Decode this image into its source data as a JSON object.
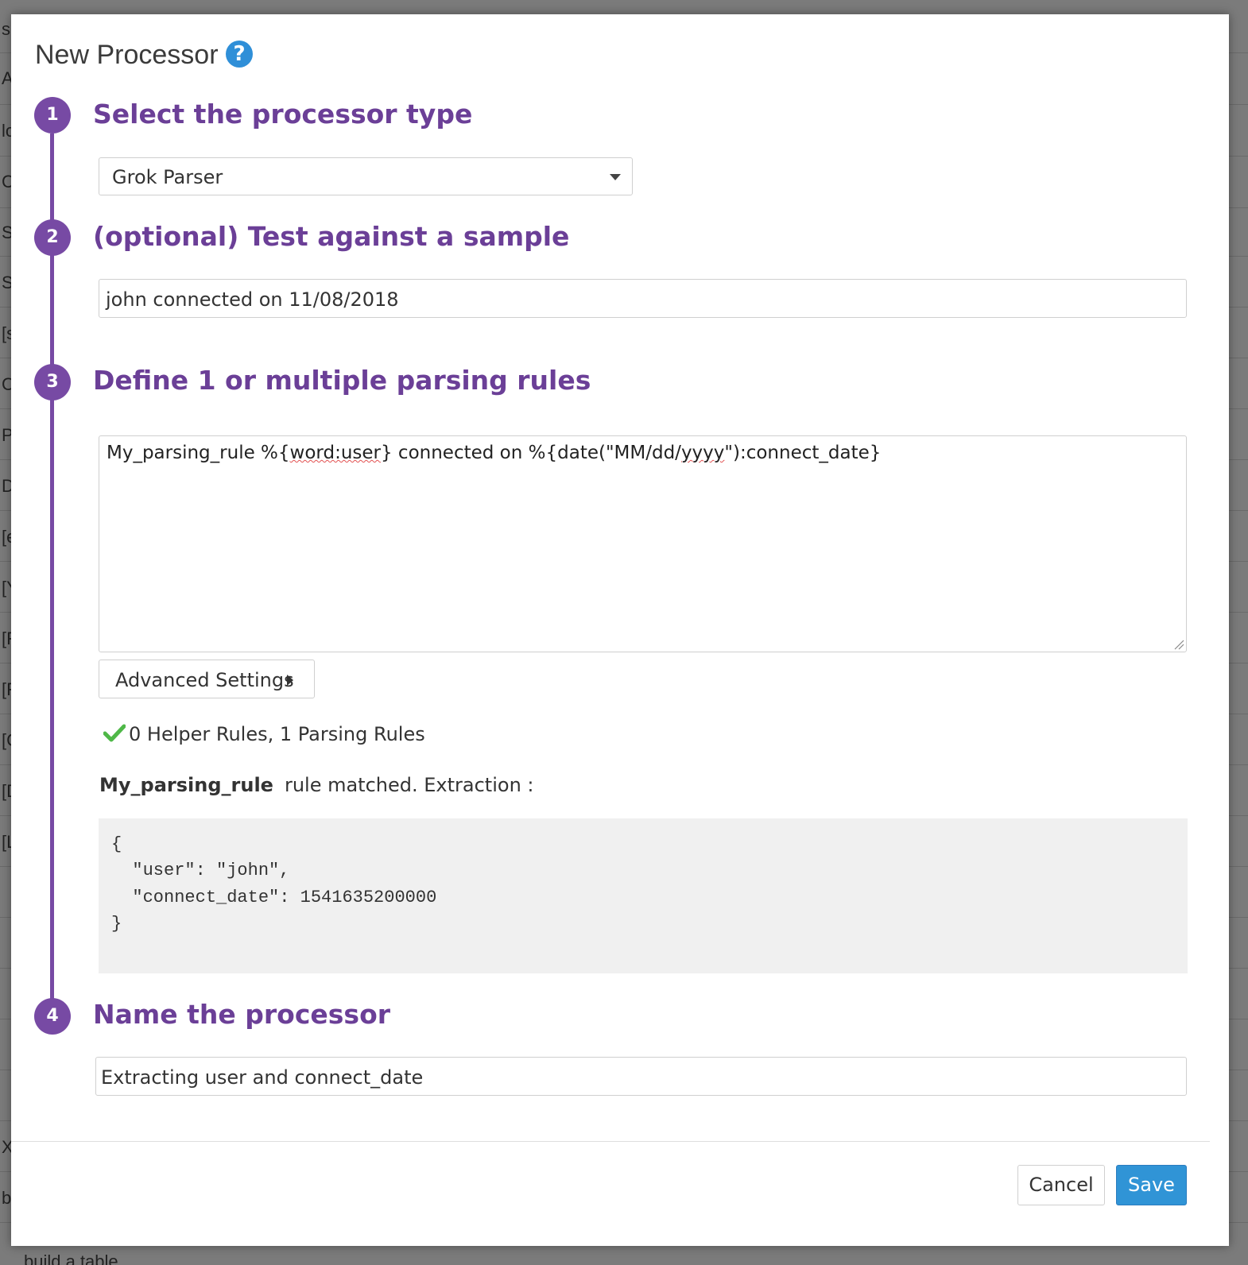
{
  "modal": {
    "title": "New Processor",
    "help_icon": "?"
  },
  "steps": [
    {
      "number": "1",
      "heading": "Select the processor type"
    },
    {
      "number": "2",
      "heading": "(optional) Test against a sample"
    },
    {
      "number": "3",
      "heading": "Define 1 or multiple parsing rules"
    },
    {
      "number": "4",
      "heading": "Name the processor"
    }
  ],
  "processor_type": {
    "selected": "Grok Parser"
  },
  "sample": {
    "value": "john connected on 11/08/2018"
  },
  "parsing_rules": {
    "value_parts": [
      "My_parsing_rule %{",
      "word:user",
      "} connected on %{date(\"MM/dd/",
      "yyyy",
      "\"):connect_date}"
    ],
    "advanced_settings_label": "Advanced Settings",
    "summary": "0 Helper Rules, 1 Parsing Rules",
    "match_rule_name": "My_parsing_rule",
    "match_text": "rule matched. Extraction :",
    "extraction_lines": [
      "{",
      "  \"user\": \"john\",",
      "  \"connect_date\": 1541635200000",
      "}"
    ]
  },
  "processor_name": {
    "value": "Extracting user and connect_date"
  },
  "footer": {
    "cancel_label": "Cancel",
    "save_label": "Save"
  },
  "colors": {
    "accent_purple": "#774aa4",
    "heading_purple": "#6b3f97",
    "save_blue": "#3094d6",
    "check_green": "#4fb848"
  },
  "background": {
    "edge_letters": [
      "s",
      "A",
      "lo",
      "C",
      "S",
      "S",
      "[s",
      "C",
      "P",
      "D",
      "[e",
      "[Y",
      "[F",
      "[F",
      "[C",
      "[D",
      "[L",
      "X",
      "b"
    ],
    "bottom_text": "build a table"
  }
}
